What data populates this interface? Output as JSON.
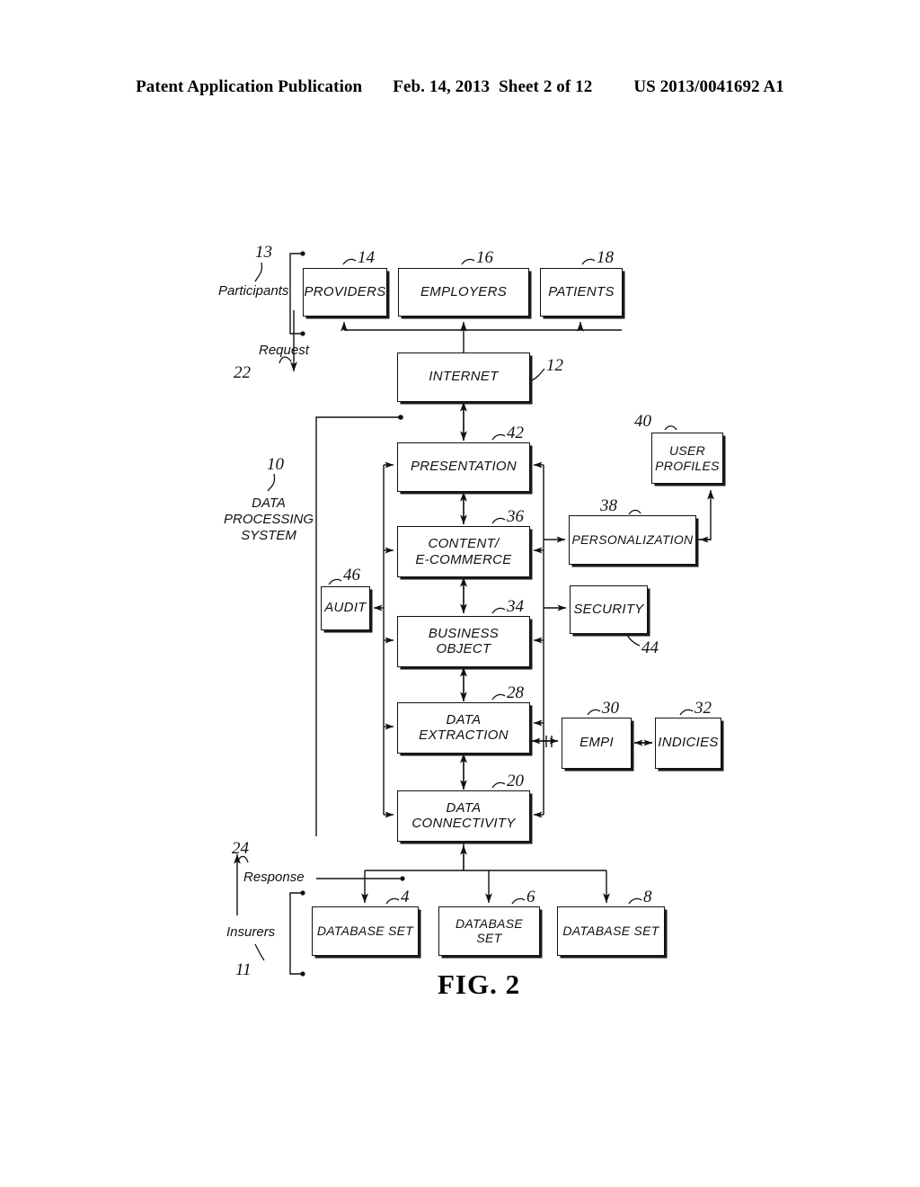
{
  "header": {
    "publication": "Patent Application Publication",
    "date": "Feb. 14, 2013",
    "sheet": "Sheet 2 of 12",
    "patent_number": "US 2013/0041692 A1"
  },
  "figure": {
    "caption": "FIG. 2",
    "boxes": [
      {
        "id": "providers",
        "label": "PROVIDERS",
        "ref": "14"
      },
      {
        "id": "employers",
        "label": "EMPLOYERS",
        "ref": "16"
      },
      {
        "id": "patients",
        "label": "PATIENTS",
        "ref": "18"
      },
      {
        "id": "internet",
        "label": "INTERNET",
        "ref": "12"
      },
      {
        "id": "presentation",
        "label": "PRESENTATION",
        "ref": "42"
      },
      {
        "id": "content",
        "label": "CONTENT/\nE-COMMERCE",
        "ref": "36"
      },
      {
        "id": "business-object",
        "label": "BUSINESS OBJECT",
        "ref": "34"
      },
      {
        "id": "data-extraction",
        "label": "DATA EXTRACTION",
        "ref": "28"
      },
      {
        "id": "data-connectivity",
        "label": "DATA CONNECTIVITY",
        "ref": "20"
      },
      {
        "id": "audit",
        "label": "AUDIT",
        "ref": "46"
      },
      {
        "id": "user-profiles",
        "label": "USER\nPROFILES",
        "ref": "40"
      },
      {
        "id": "personalization",
        "label": "PERSONALIZATION",
        "ref": "38"
      },
      {
        "id": "security",
        "label": "SECURITY",
        "ref": "44"
      },
      {
        "id": "empi",
        "label": "EMPI",
        "ref": "30"
      },
      {
        "id": "indicies",
        "label": "INDICIES",
        "ref": "32"
      },
      {
        "id": "database-set-1",
        "label": "DATABASE SET",
        "ref": "4"
      },
      {
        "id": "database-set-2",
        "label": "DATABASE SET",
        "ref": "6"
      },
      {
        "id": "database-set-3",
        "label": "DATABASE SET",
        "ref": "8"
      }
    ],
    "annotations": [
      {
        "id": "participants",
        "label": "Participants",
        "ref": "13"
      },
      {
        "id": "request",
        "label": "Request",
        "ref": "22"
      },
      {
        "id": "response",
        "label": "Response",
        "ref": "24"
      },
      {
        "id": "insurers",
        "label": "Insurers",
        "ref": "11"
      },
      {
        "id": "dps",
        "label": "DATA PROCESSING\nSYSTEM",
        "ref": "10"
      }
    ]
  }
}
